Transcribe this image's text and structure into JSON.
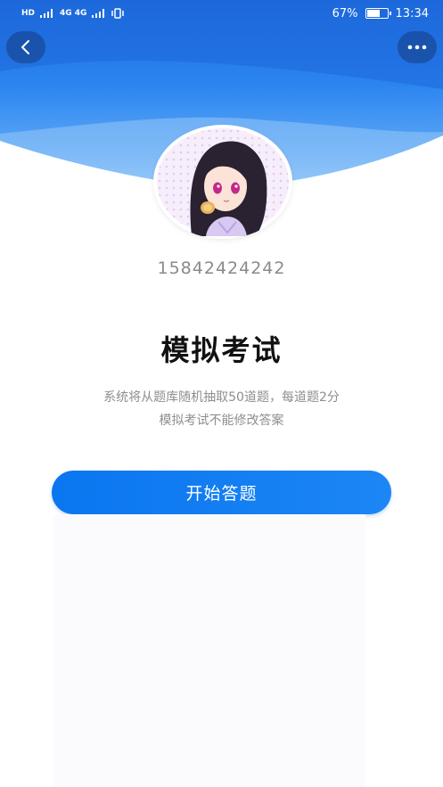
{
  "status_bar": {
    "network_label": "4G 4G",
    "battery": "67%",
    "battery_level": 0.67,
    "time": "13:34"
  },
  "header": {
    "back_icon": "chevron-left-icon",
    "more_icon": "more-dots-icon",
    "gradient_top": "#1f6fe0",
    "gradient_bottom": "#8cc4fa"
  },
  "profile": {
    "avatar_icon": "avatar-anime-girl",
    "phone": "15842424242"
  },
  "exam": {
    "title": "模拟考试",
    "desc_line1": "系统将从题库随机抽取50道题，每道题2分",
    "desc_line2": "模拟考试不能修改答案",
    "start_label": "开始答题",
    "accent": "#0a76f0"
  }
}
